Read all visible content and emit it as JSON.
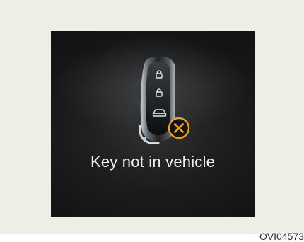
{
  "display": {
    "message": "Key not in vehicle",
    "icons": {
      "key_fob": "smart-key-fob-icon",
      "lock_button": "lock-icon",
      "unlock_button": "unlock-icon",
      "trunk_button": "trunk-icon",
      "status_badge": "close-x-icon"
    },
    "colors": {
      "display_background": "#1a1b1c",
      "text": "#f2f2f2",
      "warning_accent": "#f0a02a"
    }
  },
  "figure": {
    "code": "OVI04573"
  }
}
